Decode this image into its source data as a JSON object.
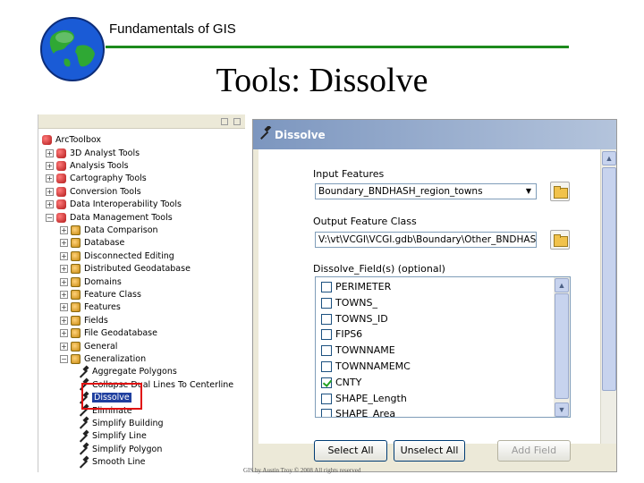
{
  "slide": {
    "header": "Fundamentals of GIS",
    "title": "Tools: Dissolve",
    "footer": "GIS by Austin Troy © 2008 All rights reserved"
  },
  "toolbox": {
    "root": "ArcToolbox",
    "items": [
      {
        "label": "3D Analyst Tools",
        "level": 1,
        "expanded": false
      },
      {
        "label": "Analysis Tools",
        "level": 1,
        "expanded": false
      },
      {
        "label": "Cartography Tools",
        "level": 1,
        "expanded": false
      },
      {
        "label": "Conversion Tools",
        "level": 1,
        "expanded": false
      },
      {
        "label": "Data Interoperability Tools",
        "level": 1,
        "expanded": false
      },
      {
        "label": "Data Management Tools",
        "level": 1,
        "expanded": true
      },
      {
        "label": "Data Comparison",
        "level": 2,
        "expanded": false
      },
      {
        "label": "Database",
        "level": 2,
        "expanded": false
      },
      {
        "label": "Disconnected Editing",
        "level": 2,
        "expanded": false
      },
      {
        "label": "Distributed Geodatabase",
        "level": 2,
        "expanded": false
      },
      {
        "label": "Domains",
        "level": 2,
        "expanded": false
      },
      {
        "label": "Feature Class",
        "level": 2,
        "expanded": false
      },
      {
        "label": "Features",
        "level": 2,
        "expanded": false
      },
      {
        "label": "Fields",
        "level": 2,
        "expanded": false
      },
      {
        "label": "File Geodatabase",
        "level": 2,
        "expanded": false
      },
      {
        "label": "General",
        "level": 2,
        "expanded": false
      },
      {
        "label": "Generalization",
        "level": 2,
        "expanded": true
      },
      {
        "label": "Aggregate Polygons",
        "level": 3
      },
      {
        "label": "Collapse Dual Lines To Centerline",
        "level": 3
      },
      {
        "label": "Dissolve",
        "level": 3,
        "selected": true
      },
      {
        "label": "Eliminate",
        "level": 3
      },
      {
        "label": "Simplify Building",
        "level": 3
      },
      {
        "label": "Simplify Line",
        "level": 3
      },
      {
        "label": "Simplify Polygon",
        "level": 3
      },
      {
        "label": "Smooth Line",
        "level": 3
      }
    ]
  },
  "dialog": {
    "title": "Dissolve",
    "input_features_label": "Input Features",
    "input_features_value": "Boundary_BNDHASH_region_towns",
    "output_class_label": "Output Feature Class",
    "output_class_value": "V:\\vt\\VCGI\\VCGI.gdb\\Boundary\\Other_BNDHASH",
    "dissolve_fields_label": "Dissolve_Field(s) (optional)",
    "fields": [
      {
        "name": "PERIMETER",
        "checked": false
      },
      {
        "name": "TOWNS_",
        "checked": false
      },
      {
        "name": "TOWNS_ID",
        "checked": false
      },
      {
        "name": "FIPS6",
        "checked": false
      },
      {
        "name": "TOWNNAME",
        "checked": false
      },
      {
        "name": "TOWNNAMEMC",
        "checked": false
      },
      {
        "name": "CNTY",
        "checked": true
      },
      {
        "name": "SHAPE_Length",
        "checked": false
      },
      {
        "name": "SHAPE_Area",
        "checked": false
      }
    ],
    "select_all_label": "Select All",
    "unselect_all_label": "Unselect All",
    "add_field_label": "Add Field"
  },
  "colors": {
    "header_rule": "#1d8a1d",
    "highlight_box": "#e01010",
    "selection": "#1f3f9f",
    "dialog_title": "#7c96bf"
  }
}
